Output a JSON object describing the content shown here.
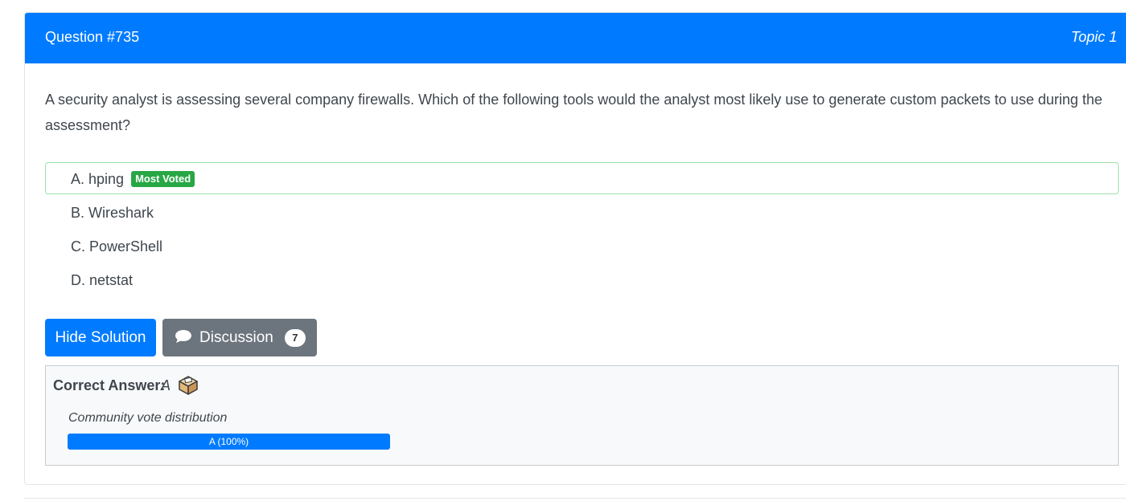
{
  "question": {
    "title": "Question #735",
    "topic": "Topic 1",
    "text": "A security analyst is assessing several company firewalls. Which of the following tools would the analyst most likely use to generate custom packets to use during the assessment?"
  },
  "choices": [
    {
      "label": "A. hping",
      "badge": "Most Voted",
      "correct": true
    },
    {
      "label": "B. Wireshark"
    },
    {
      "label": "C. PowerShell"
    },
    {
      "label": "D. netstat"
    }
  ],
  "buttons": {
    "hide_solution": "Hide Solution",
    "discussion": "Discussion",
    "discussion_count": "7"
  },
  "answer": {
    "label": "Correct Answer:",
    "value": "A",
    "vote_label": "Community vote distribution",
    "vote_bar_text": "A (100%)",
    "vote_percent": 100
  },
  "colors": {
    "primary": "#007bff",
    "success": "#28a745",
    "secondary": "#6c757d",
    "correct_border": "#9be3a9"
  },
  "icons": {
    "discussion": "speech-bubble-icon",
    "answer": "ballot-box-icon"
  }
}
